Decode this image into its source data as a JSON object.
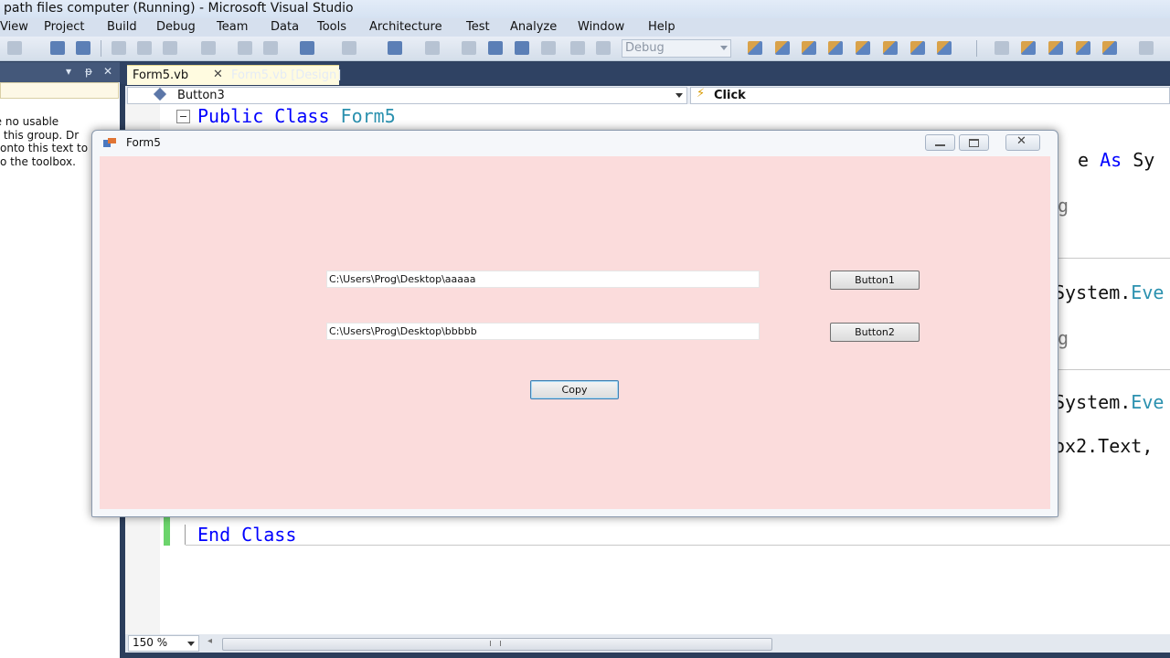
{
  "window": {
    "title": "path files computer (Running) - Microsoft Visual Studio"
  },
  "menu": [
    "View",
    "Project",
    "Build",
    "Debug",
    "Team",
    "Data",
    "Tools",
    "Architecture",
    "Test",
    "Analyze",
    "Window",
    "Help"
  ],
  "toolbar": {
    "config": "Debug"
  },
  "toolbox": {
    "header_controls": [
      "▾",
      "ᵽ",
      "✕"
    ],
    "message": "re no usable\n this group. Dr\nonto this text to\no the toolbox."
  },
  "tabs": {
    "active": "Form5.vb",
    "inactive": "Form5.vb [Design]",
    "close": "✕"
  },
  "navbar": {
    "object": "Button3",
    "event": "Click"
  },
  "code": {
    "line1_kw": "Public Class",
    "line1_type": "Form5",
    "frag1_a": "e",
    "frag1_b": "As",
    "frag1_c": "Sy",
    "frag2": "g",
    "frag3_a": "System.",
    "frag3_b": "Eve",
    "frag4": "g",
    "frag5_a": "System.",
    "frag5_b": "Eve",
    "frag6": "ox2.Text,",
    "end_class": "End Class"
  },
  "statusbar": {
    "zoom": "150 %"
  },
  "form5": {
    "title": "Form5",
    "textbox1": "C:\\Users\\Prog\\Desktop\\aaaaa",
    "textbox2": "C:\\Users\\Prog\\Desktop\\bbbbb",
    "button1": "Button1",
    "button2": "Button2",
    "copy": "Copy",
    "close_glyph": "✕"
  }
}
